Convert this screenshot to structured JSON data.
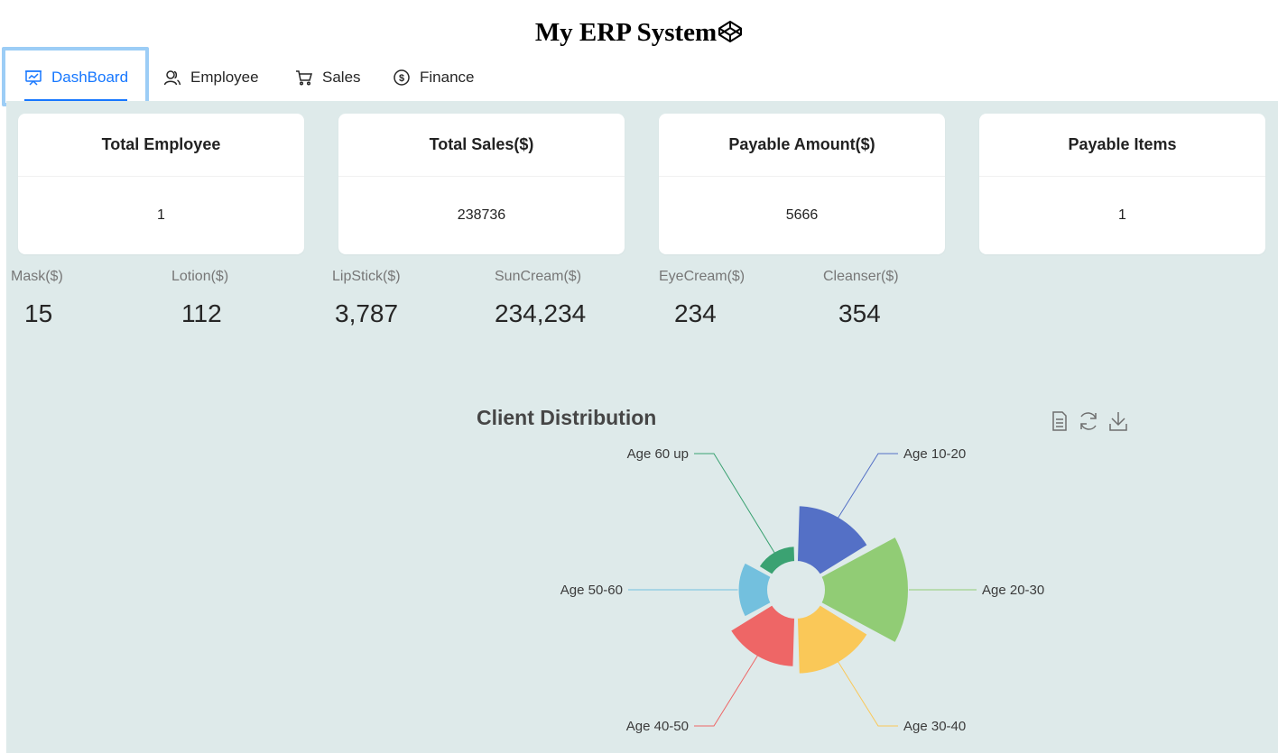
{
  "app": {
    "title": "My ERP System"
  },
  "nav": {
    "items": [
      {
        "label": "DashBoard",
        "icon": "dashboard-icon"
      },
      {
        "label": "Employee",
        "icon": "employee-icon"
      },
      {
        "label": "Sales",
        "icon": "cart-icon"
      },
      {
        "label": "Finance",
        "icon": "dollar-icon"
      }
    ],
    "active": "DashBoard",
    "accent_color": "#1677ff"
  },
  "cards": [
    {
      "title": "Total Employee",
      "value": "1"
    },
    {
      "title": "Total Sales($)",
      "value": "238736"
    },
    {
      "title": "Payable Amount($)",
      "value": "5666"
    },
    {
      "title": "Payable Items",
      "value": "1"
    }
  ],
  "stats": [
    {
      "title": "Mask($)",
      "value": "15"
    },
    {
      "title": "Lotion($)",
      "value": "112"
    },
    {
      "title": "LipStick($)",
      "value": "3,787"
    },
    {
      "title": "SunCream($)",
      "value": "234,234"
    },
    {
      "title": "EyeCream($)",
      "value": "234"
    },
    {
      "title": "Cleanser($)",
      "value": "354"
    }
  ],
  "toolbox": {
    "icons": [
      "data-view-icon",
      "restore-icon",
      "save-image-icon"
    ]
  },
  "chart_data": {
    "type": "pie",
    "subtype": "rose",
    "title": "Client Distribution",
    "categories": [
      "Age 10-20",
      "Age 20-30",
      "Age 30-40",
      "Age 40-50",
      "Age 50-60",
      "Age 60 up"
    ],
    "values": [
      96,
      128,
      96,
      88,
      66,
      50
    ],
    "colors": [
      "#5470c6",
      "#91cc75",
      "#fac858",
      "#ee6666",
      "#73c0de",
      "#3ba272"
    ],
    "background": "#deeaea"
  }
}
